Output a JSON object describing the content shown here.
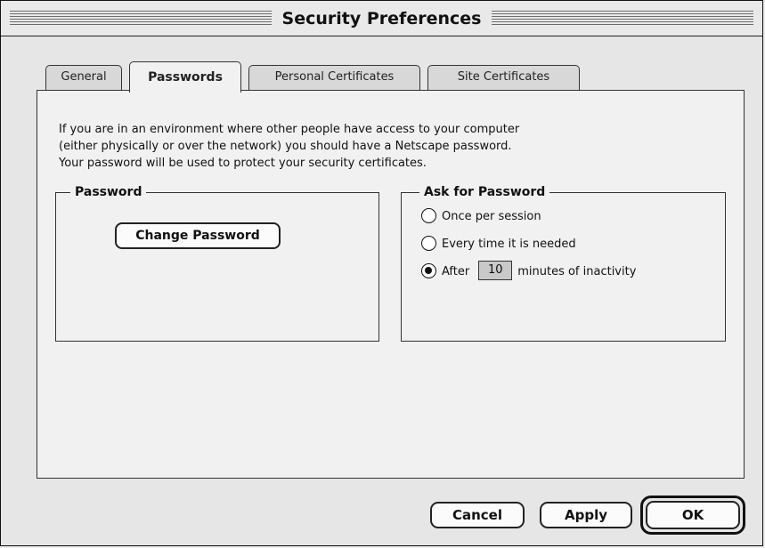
{
  "window": {
    "title": "Security Preferences"
  },
  "tabs": [
    {
      "label": "General",
      "active": false
    },
    {
      "label": "Passwords",
      "active": true
    },
    {
      "label": "Personal Certificates",
      "active": false
    },
    {
      "label": "Site Certificates",
      "active": false
    }
  ],
  "intro_lines": [
    "If you are in an environment where other people have access to your computer",
    "(either physically or over the network) you should have a Netscape password.",
    "Your password will be used to protect your security certificates."
  ],
  "password_group": {
    "label": "Password",
    "change_button": "Change Password"
  },
  "ask_group": {
    "label": "Ask for Password",
    "options": [
      {
        "label": "Once per session",
        "selected": false
      },
      {
        "label": "Every time it is needed",
        "selected": false
      },
      {
        "label_before": "After",
        "label_after": "minutes of inactivity",
        "selected": true
      }
    ],
    "minutes_value": "10"
  },
  "footer": {
    "cancel": "Cancel",
    "apply": "Apply",
    "ok": "OK"
  }
}
